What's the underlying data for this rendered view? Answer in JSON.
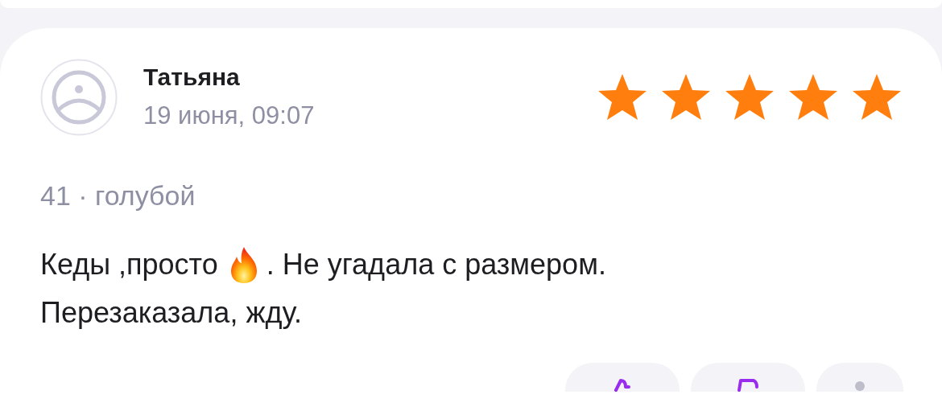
{
  "review": {
    "author": "Татьяна",
    "date": "19 июня, 09:07",
    "stars": 5,
    "variant": "41 · голубой",
    "text": [
      {
        "kind": "text",
        "value": "Кеды ,просто"
      },
      {
        "kind": "fire"
      },
      {
        "kind": "text",
        "value": ". Не угадала с размером."
      },
      {
        "kind": "break"
      },
      {
        "kind": "text",
        "value": "Перезаказала, жду."
      }
    ],
    "actions": [
      {
        "kind": "like"
      },
      {
        "kind": "dislike"
      },
      {
        "kind": "more"
      }
    ]
  }
}
